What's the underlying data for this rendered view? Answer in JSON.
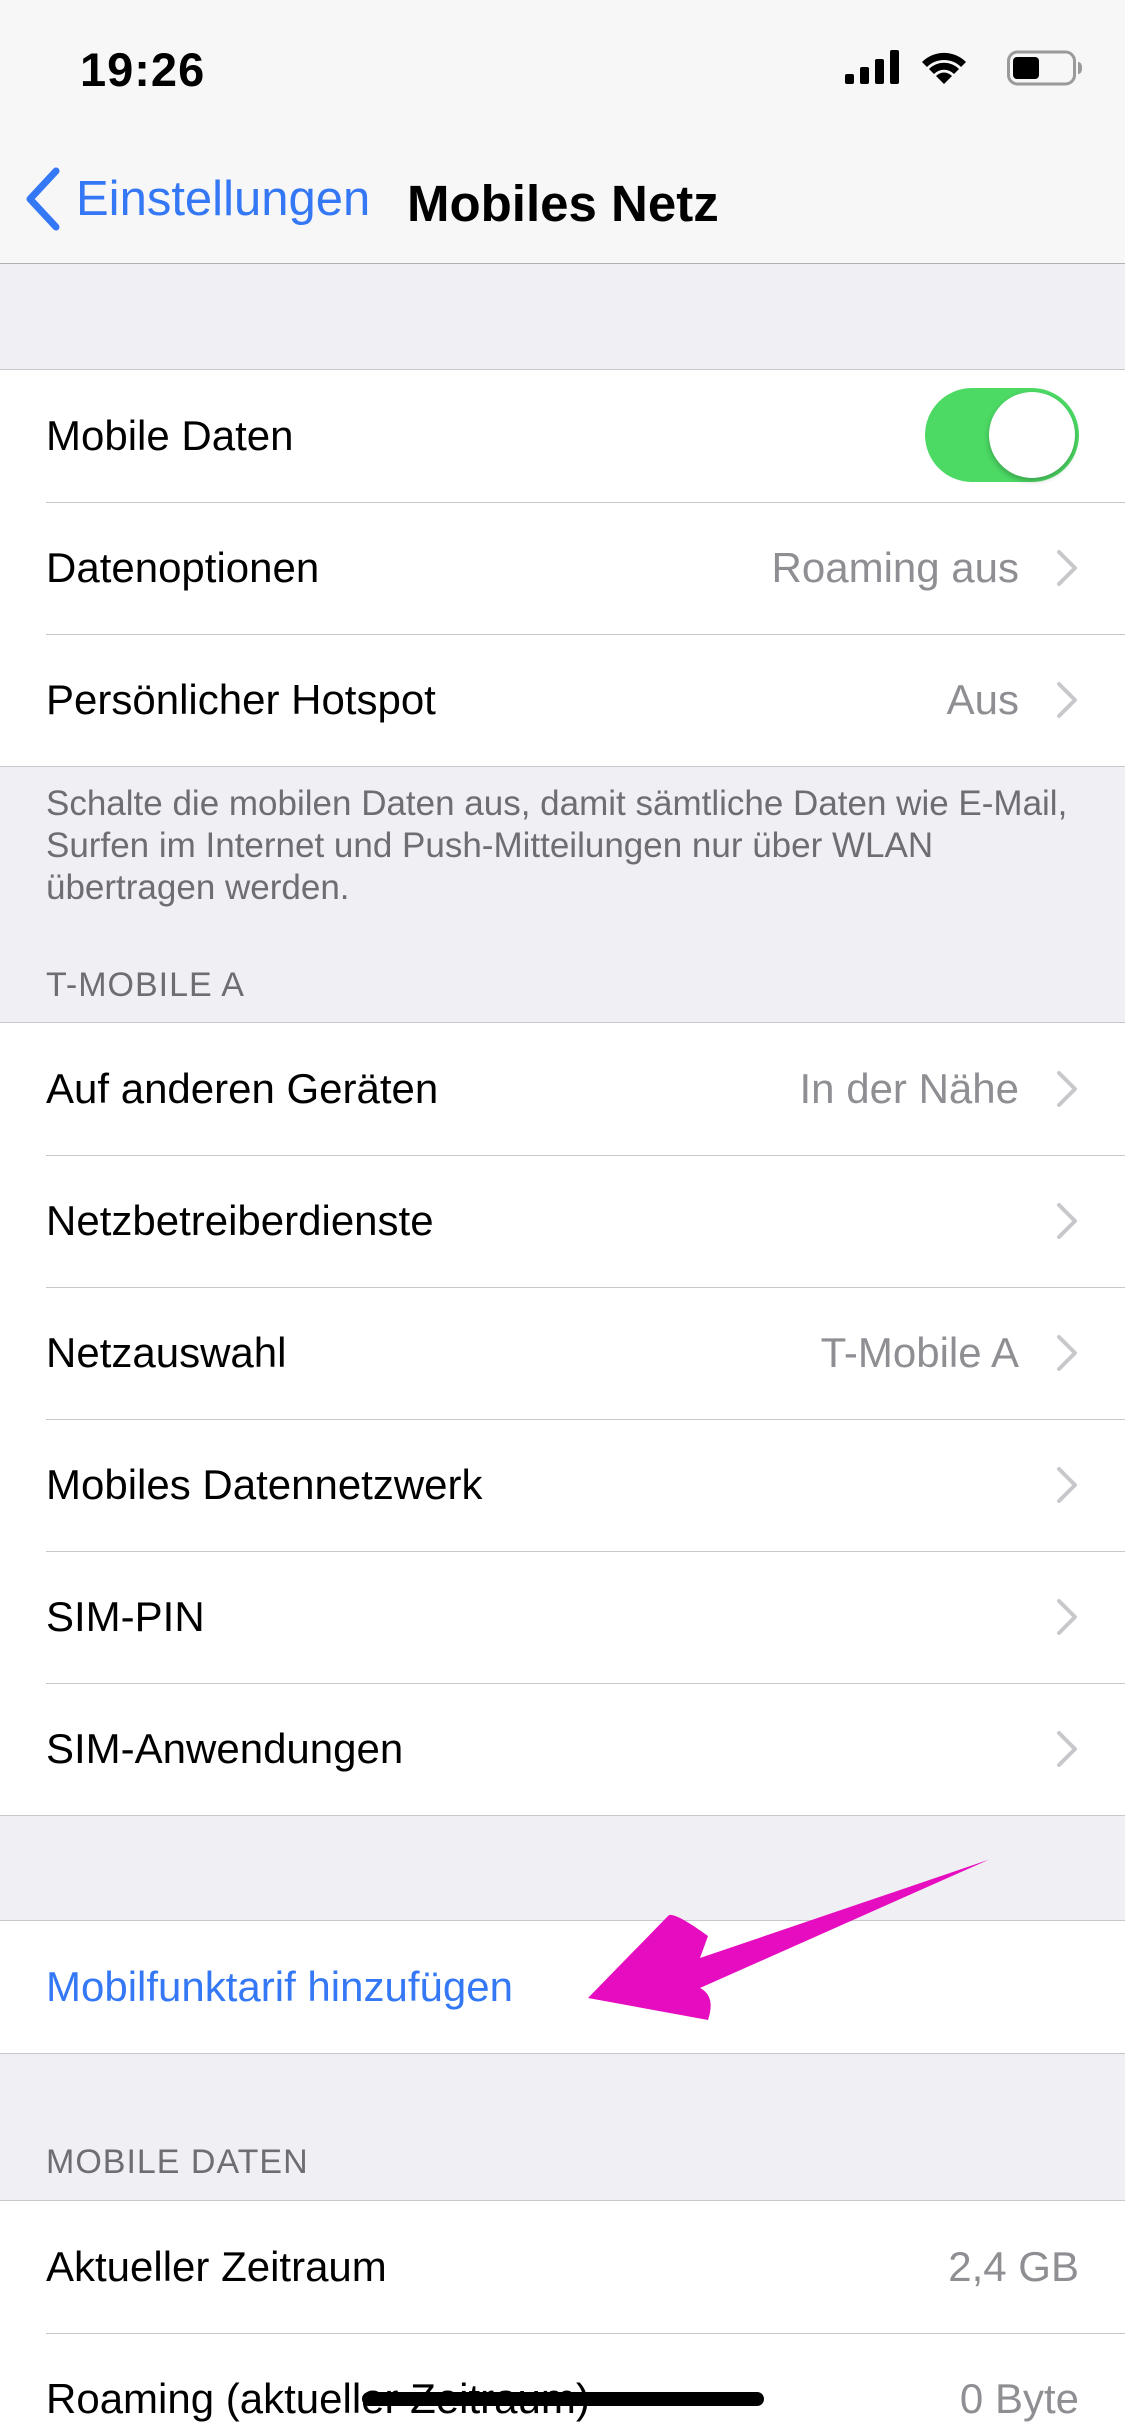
{
  "status_bar": {
    "time": "19:26",
    "icons": [
      "signal-icon",
      "wifi-icon",
      "battery-icon"
    ]
  },
  "nav": {
    "back_label": "Einstellungen",
    "title": "Mobiles Netz"
  },
  "group1": {
    "mobile_data": {
      "label": "Mobile Daten",
      "toggle_on": true
    },
    "data_options": {
      "label": "Datenoptionen",
      "value": "Roaming aus"
    },
    "hotspot": {
      "label": "Persönlicher Hotspot",
      "value": "Aus"
    },
    "footer": "Schalte die mobilen Daten aus, damit sämtliche Daten wie E-Mail, Surfen im Internet und Push-Mitteilungen nur über WLAN übertragen werden."
  },
  "carrier_section": {
    "header": "T-MOBILE A",
    "rows": [
      {
        "label": "Auf anderen Geräten",
        "value": "In der Nähe"
      },
      {
        "label": "Netzbetreiberdienste",
        "value": ""
      },
      {
        "label": "Netzauswahl",
        "value": "T-Mobile A"
      },
      {
        "label": "Mobiles Datennetzwerk",
        "value": ""
      },
      {
        "label": "SIM-PIN",
        "value": ""
      },
      {
        "label": "SIM-Anwendungen",
        "value": ""
      }
    ]
  },
  "add_plan": {
    "label": "Mobilfunktarif hinzufügen"
  },
  "usage_section": {
    "header": "MOBILE DATEN",
    "current_period": {
      "label": "Aktueller Zeitraum",
      "value": "2,4 GB"
    },
    "roaming_period": {
      "label": "Roaming (aktueller Zeitraum)",
      "value": "0 Byte"
    }
  },
  "colors": {
    "accent": "#3478f6",
    "toggle_on": "#4cd964",
    "annotation_arrow": "#e60cbf"
  }
}
